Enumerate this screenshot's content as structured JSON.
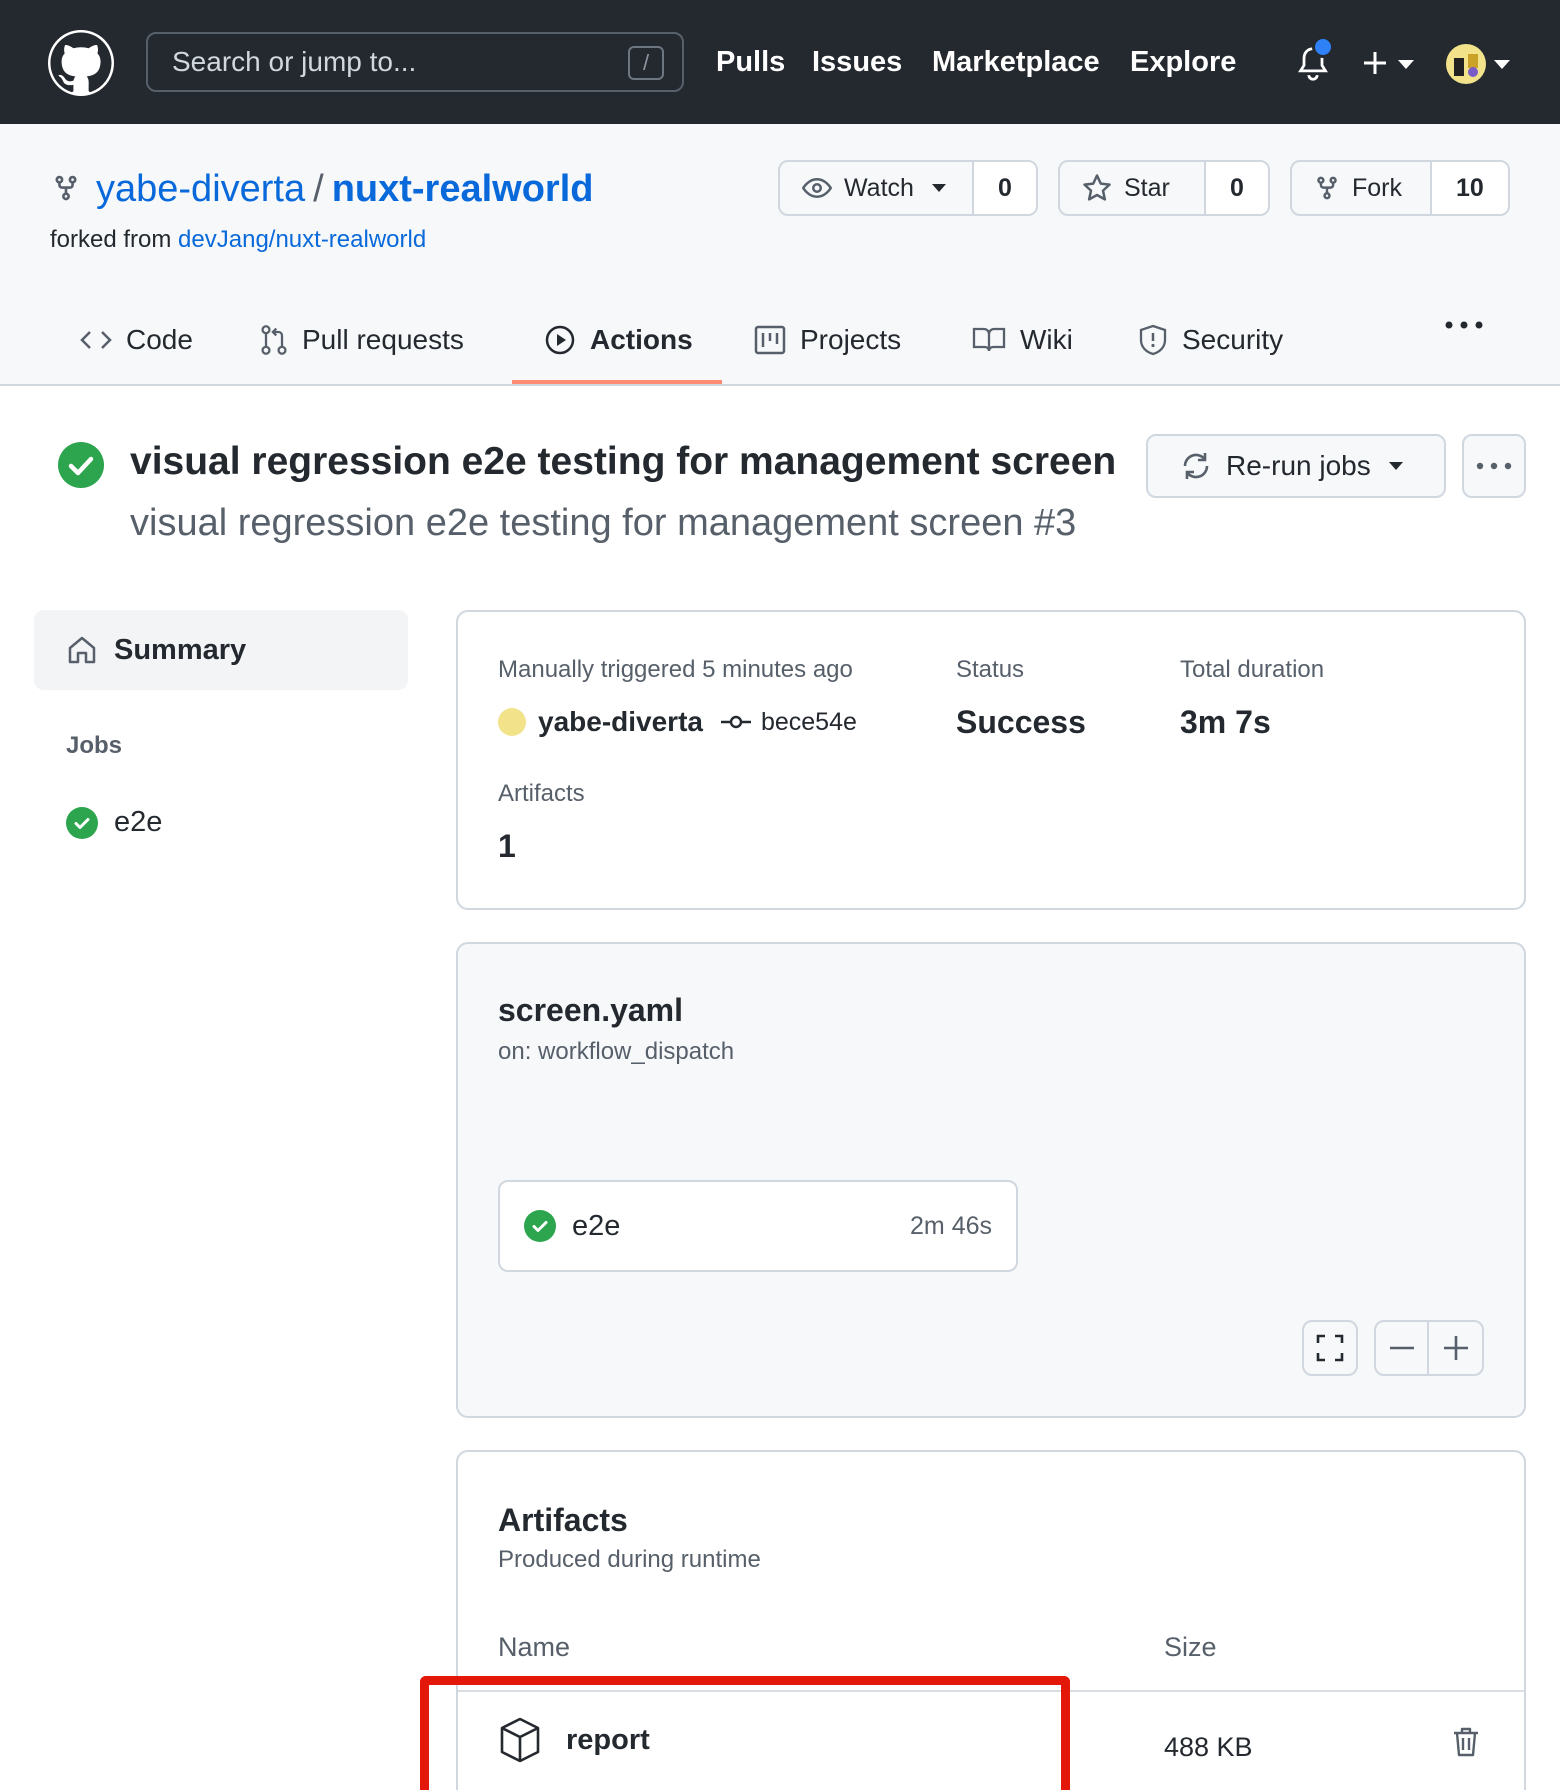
{
  "header": {
    "search_placeholder": "Search or jump to...",
    "search_key": "/",
    "nav": [
      "Pulls",
      "Issues",
      "Marketplace",
      "Explore"
    ]
  },
  "repo": {
    "owner": "yabe-diverta",
    "separator": "/",
    "name": "nuxt-realworld",
    "forked_from_label": "forked from",
    "forked_from": "devJang/nuxt-realworld",
    "watch_label": "Watch",
    "watch_count": "0",
    "star_label": "Star",
    "star_count": "0",
    "fork_label": "Fork",
    "fork_count": "10"
  },
  "tabs": [
    {
      "label": "Code",
      "icon": "code-icon"
    },
    {
      "label": "Pull requests",
      "icon": "git-pull-request-icon"
    },
    {
      "label": "Actions",
      "icon": "play-icon",
      "active": true
    },
    {
      "label": "Projects",
      "icon": "project-icon"
    },
    {
      "label": "Wiki",
      "icon": "book-icon"
    },
    {
      "label": "Security",
      "icon": "shield-icon"
    }
  ],
  "run": {
    "title": "visual regression e2e testing for management screen",
    "subtitle": "visual regression e2e testing for management screen #3",
    "rerun_label": "Re-run jobs"
  },
  "sidebar": {
    "summary_label": "Summary",
    "jobs_heading": "Jobs",
    "jobs": [
      "e2e"
    ]
  },
  "summary": {
    "trigger_label": "Manually triggered 5 minutes ago",
    "actor": "yabe-diverta",
    "commit": "bece54e",
    "status_label": "Status",
    "status_value": "Success",
    "duration_label": "Total duration",
    "duration_value": "3m 7s",
    "artifacts_label": "Artifacts",
    "artifacts_value": "1"
  },
  "workflow": {
    "file": "screen.yaml",
    "trigger": "on: workflow_dispatch",
    "job_name": "e2e",
    "job_duration": "2m 46s"
  },
  "artifacts": {
    "title": "Artifacts",
    "subtitle": "Produced during runtime",
    "col_name": "Name",
    "col_size": "Size",
    "items": [
      {
        "name": "report",
        "size": "488 KB"
      }
    ]
  },
  "colors": {
    "header_bg": "#24292f",
    "link": "#0969da",
    "success": "#2da44e",
    "active_tab_underline": "#fd8c73",
    "highlight": "#e3170a"
  }
}
